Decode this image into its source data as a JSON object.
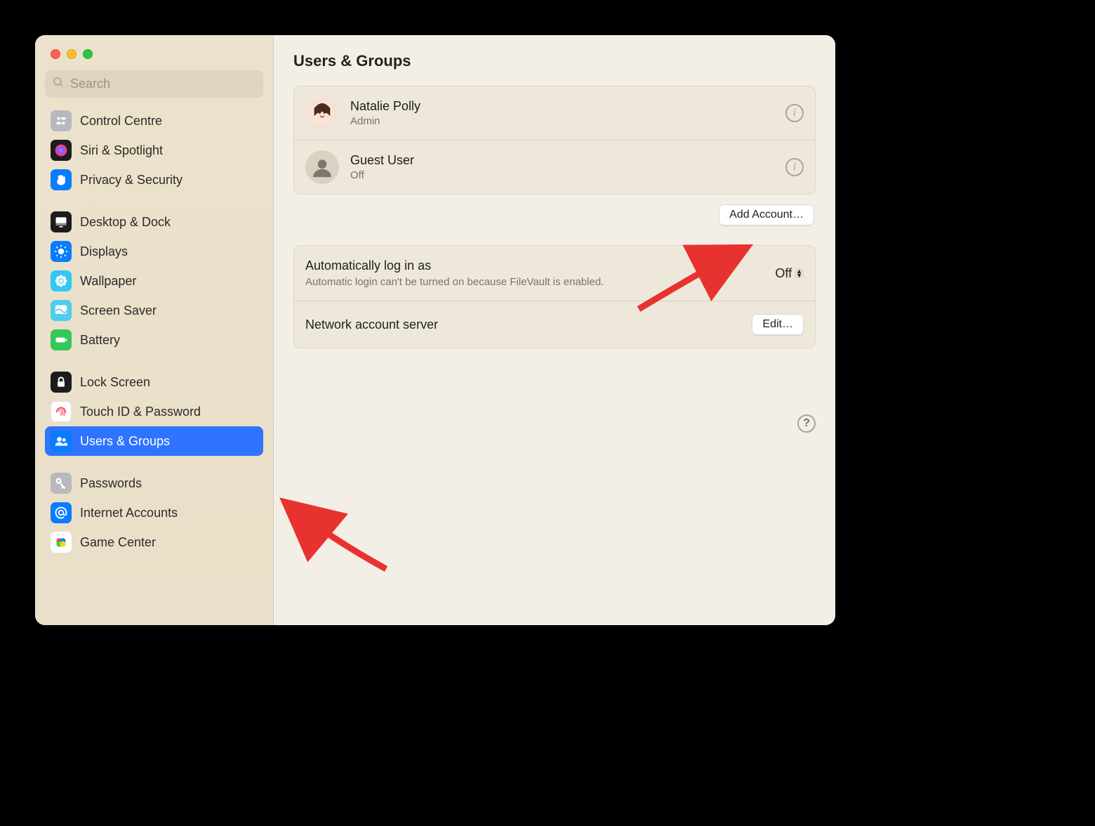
{
  "title": "Users & Groups",
  "search": {
    "placeholder": "Search"
  },
  "sidebar": {
    "groups": [
      [
        {
          "label": "Control Centre",
          "icon": "control-centre-icon",
          "color": "#b8b8bf"
        },
        {
          "label": "Siri & Spotlight",
          "icon": "siri-icon",
          "color": "#1c1c1e"
        },
        {
          "label": "Privacy & Security",
          "icon": "hand-icon",
          "color": "#0a7cff"
        }
      ],
      [
        {
          "label": "Desktop & Dock",
          "icon": "desktop-icon",
          "color": "#1c1c1e"
        },
        {
          "label": "Displays",
          "icon": "sun-icon",
          "color": "#0a7cff"
        },
        {
          "label": "Wallpaper",
          "icon": "flower-icon",
          "color": "#34c7f4"
        },
        {
          "label": "Screen Saver",
          "icon": "screensaver-icon",
          "color": "#4ecdee"
        },
        {
          "label": "Battery",
          "icon": "battery-icon",
          "color": "#34c759"
        }
      ],
      [
        {
          "label": "Lock Screen",
          "icon": "lock-icon",
          "color": "#1c1c1e"
        },
        {
          "label": "Touch ID & Password",
          "icon": "fingerprint-icon",
          "color": "#ffffff",
          "iconColor": "#ff4f64",
          "border": true
        },
        {
          "label": "Users & Groups",
          "icon": "users-icon",
          "color": "#0a7cff",
          "selected": true
        }
      ],
      [
        {
          "label": "Passwords",
          "icon": "key-icon",
          "color": "#b8b8bf"
        },
        {
          "label": "Internet Accounts",
          "icon": "at-icon",
          "color": "#0a7cff"
        },
        {
          "label": "Game Center",
          "icon": "gamecenter-icon",
          "color": "#ffffff",
          "multicolor": true
        }
      ]
    ]
  },
  "users": [
    {
      "name": "Natalie Polly",
      "role": "Admin",
      "avatar": "memoji"
    },
    {
      "name": "Guest User",
      "role": "Off",
      "avatar": "generic"
    }
  ],
  "addAccount": "Add Account…",
  "autoLogin": {
    "label": "Automatically log in as",
    "value": "Off",
    "note": "Automatic login can't be turned on because FileVault is enabled."
  },
  "networkServer": {
    "label": "Network account server",
    "button": "Edit…"
  },
  "helpLabel": "?"
}
